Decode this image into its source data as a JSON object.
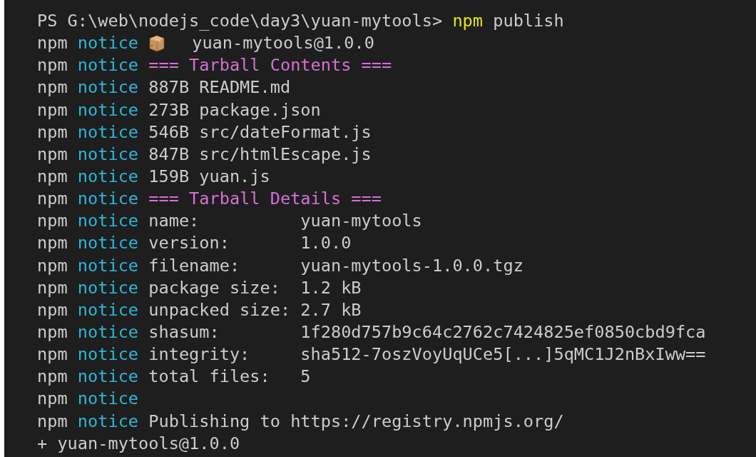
{
  "terminal": {
    "lines": [
      {
        "segments": [
          {
            "kind": "prompt",
            "text": "PS G:\\web\\nodejs_code\\day3\\yuan-mytools>"
          },
          {
            "kind": "command",
            "text": "npm"
          },
          {
            "kind": "plain",
            "text": "publish"
          }
        ]
      },
      {
        "segments": [
          {
            "kind": "prefix",
            "text": "npm"
          },
          {
            "kind": "level",
            "text": "notice"
          },
          {
            "kind": "package-icon"
          },
          {
            "kind": "plain",
            "text": " yuan-mytools@1.0.0"
          }
        ]
      },
      {
        "segments": [
          {
            "kind": "prefix",
            "text": "npm"
          },
          {
            "kind": "level",
            "text": "notice"
          },
          {
            "kind": "heading",
            "text": "=== Tarball Contents ==="
          }
        ]
      },
      {
        "segments": [
          {
            "kind": "prefix",
            "text": "npm"
          },
          {
            "kind": "level",
            "text": "notice"
          },
          {
            "kind": "plain",
            "text": "887B README.md"
          }
        ]
      },
      {
        "segments": [
          {
            "kind": "prefix",
            "text": "npm"
          },
          {
            "kind": "level",
            "text": "notice"
          },
          {
            "kind": "plain",
            "text": "273B package.json"
          }
        ]
      },
      {
        "segments": [
          {
            "kind": "prefix",
            "text": "npm"
          },
          {
            "kind": "level",
            "text": "notice"
          },
          {
            "kind": "plain",
            "text": "546B src/dateFormat.js"
          }
        ]
      },
      {
        "segments": [
          {
            "kind": "prefix",
            "text": "npm"
          },
          {
            "kind": "level",
            "text": "notice"
          },
          {
            "kind": "plain",
            "text": "847B src/htmlEscape.js"
          }
        ]
      },
      {
        "segments": [
          {
            "kind": "prefix",
            "text": "npm"
          },
          {
            "kind": "level",
            "text": "notice"
          },
          {
            "kind": "plain",
            "text": "159B yuan.js"
          }
        ]
      },
      {
        "segments": [
          {
            "kind": "prefix",
            "text": "npm"
          },
          {
            "kind": "level",
            "text": "notice"
          },
          {
            "kind": "heading",
            "text": "=== Tarball Details ==="
          }
        ]
      },
      {
        "segments": [
          {
            "kind": "prefix",
            "text": "npm"
          },
          {
            "kind": "level",
            "text": "notice"
          },
          {
            "kind": "key",
            "text": "name:"
          },
          {
            "kind": "plain",
            "text": "yuan-mytools"
          }
        ]
      },
      {
        "segments": [
          {
            "kind": "prefix",
            "text": "npm"
          },
          {
            "kind": "level",
            "text": "notice"
          },
          {
            "kind": "key",
            "text": "version:"
          },
          {
            "kind": "plain",
            "text": "1.0.0"
          }
        ]
      },
      {
        "segments": [
          {
            "kind": "prefix",
            "text": "npm"
          },
          {
            "kind": "level",
            "text": "notice"
          },
          {
            "kind": "key",
            "text": "filename:"
          },
          {
            "kind": "plain",
            "text": "yuan-mytools-1.0.0.tgz"
          }
        ]
      },
      {
        "segments": [
          {
            "kind": "prefix",
            "text": "npm"
          },
          {
            "kind": "level",
            "text": "notice"
          },
          {
            "kind": "key",
            "text": "package size:"
          },
          {
            "kind": "plain",
            "text": "1.2 kB"
          }
        ]
      },
      {
        "segments": [
          {
            "kind": "prefix",
            "text": "npm"
          },
          {
            "kind": "level",
            "text": "notice"
          },
          {
            "kind": "key",
            "text": "unpacked size:"
          },
          {
            "kind": "plain",
            "text": "2.7 kB"
          }
        ]
      },
      {
        "segments": [
          {
            "kind": "prefix",
            "text": "npm"
          },
          {
            "kind": "level",
            "text": "notice"
          },
          {
            "kind": "key",
            "text": "shasum:"
          },
          {
            "kind": "plain",
            "text": "1f280d757b9c64c2762c7424825ef0850cbd9fca"
          }
        ]
      },
      {
        "segments": [
          {
            "kind": "prefix",
            "text": "npm"
          },
          {
            "kind": "level",
            "text": "notice"
          },
          {
            "kind": "key",
            "text": "integrity:"
          },
          {
            "kind": "plain",
            "text": "sha512-7oszVoyUqUCe5[...]5qMC1J2nBxIww=="
          }
        ]
      },
      {
        "segments": [
          {
            "kind": "prefix",
            "text": "npm"
          },
          {
            "kind": "level",
            "text": "notice"
          },
          {
            "kind": "key",
            "text": "total files:"
          },
          {
            "kind": "plain",
            "text": "5"
          }
        ]
      },
      {
        "segments": [
          {
            "kind": "prefix",
            "text": "npm"
          },
          {
            "kind": "level",
            "text": "notice"
          }
        ]
      },
      {
        "segments": [
          {
            "kind": "prefix",
            "text": "npm"
          },
          {
            "kind": "level",
            "text": "notice"
          },
          {
            "kind": "plain",
            "text": "Publishing to https://registry.npmjs.org/"
          }
        ]
      },
      {
        "segments": [
          {
            "kind": "plain",
            "text": "+ yuan-mytools@1.0.0"
          }
        ]
      }
    ]
  }
}
